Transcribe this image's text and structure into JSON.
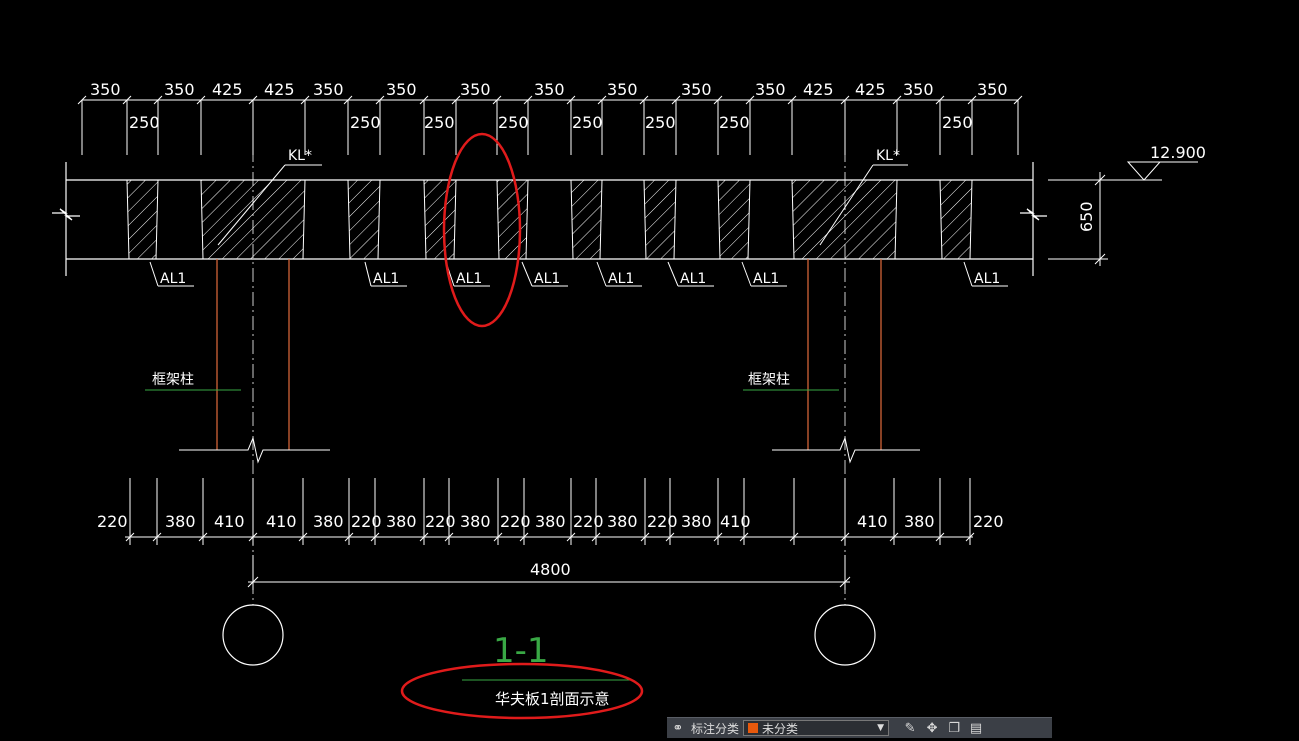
{
  "drawing": {
    "top_dims_row1": [
      "350",
      "350",
      "425",
      "425",
      "350",
      "350",
      "350",
      "350",
      "350",
      "350",
      "350",
      "425",
      "425",
      "350",
      "350"
    ],
    "top_dims_row2": [
      "250",
      "250",
      "250",
      "250",
      "250",
      "250",
      "250",
      "250"
    ],
    "beam_labels": [
      "KL*",
      "KL*"
    ],
    "elevation": "12.900",
    "height_dim": "650",
    "al_labels": [
      "AL1",
      "AL1",
      "AL1",
      "AL1",
      "AL1",
      "AL1",
      "AL1",
      "AL1"
    ],
    "column_labels": [
      "框架柱",
      "框架柱"
    ],
    "bottom_dims": [
      "220",
      "380",
      "410",
      "410",
      "380",
      "220",
      "380",
      "220",
      "380",
      "220",
      "380",
      "220",
      "380",
      "220",
      "380",
      "410",
      "410",
      "380",
      "220"
    ],
    "overall_dim": "4800",
    "section_mark": "1-1",
    "section_title": "华夫板1剖面示意"
  },
  "toolbar": {
    "label": "标注分类",
    "select_value": "未分类",
    "swatch_color": "#e8590c",
    "icons": [
      "link-icon",
      "edit-icon",
      "move-icon",
      "copy-icon",
      "paste-icon"
    ]
  },
  "colors": {
    "background": "#000000",
    "lines": "#ffffff",
    "columns": "#e36c3c",
    "leader": "#39a845",
    "highlight": "#e01b1b"
  }
}
